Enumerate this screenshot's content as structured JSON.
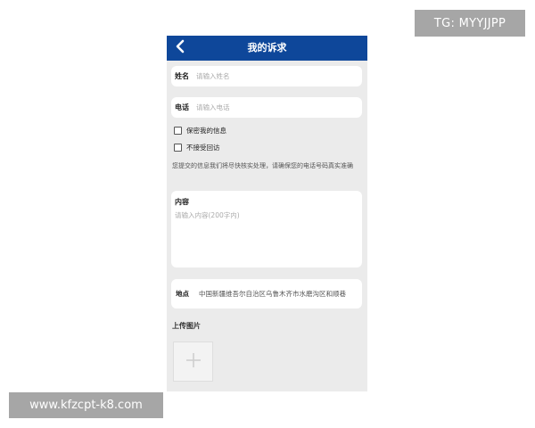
{
  "header": {
    "title": "我的诉求",
    "back_icon": "chevron-left-icon",
    "background_color": "#0e479a"
  },
  "form": {
    "name": {
      "label": "姓名",
      "placeholder": "请输入姓名",
      "value": ""
    },
    "phone": {
      "label": "电话",
      "placeholder": "请输入电话",
      "value": ""
    },
    "options": [
      {
        "label": "保密我的信息",
        "checked": false
      },
      {
        "label": "不接受回访",
        "checked": false
      }
    ],
    "notice": "您提交的信息我们将尽快核实处理，请确保您的电话号码真实准确",
    "content": {
      "label": "内容",
      "placeholder": "请输入内容(200字内)",
      "value": ""
    },
    "location": {
      "label": "地点",
      "value": "中国新疆维吾尔自治区乌鲁木齐市水磨沟区和顺巷"
    },
    "upload": {
      "label": "上传图片",
      "icon": "plus-icon"
    }
  },
  "watermarks": {
    "top_right": "TG: MYYJJPP",
    "bottom_left": "www.kfzcpt-k8.com"
  }
}
